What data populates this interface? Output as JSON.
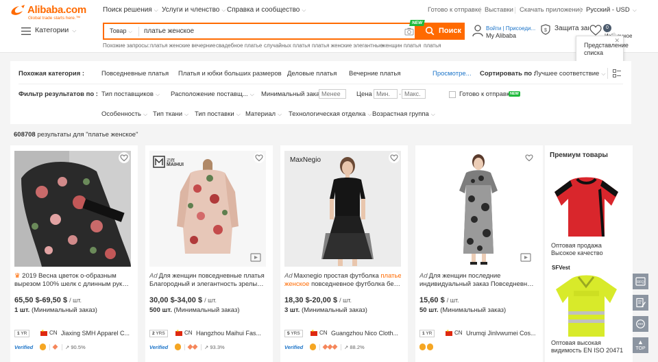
{
  "header": {
    "logo_word": "Alibaba.com",
    "logo_tagline": "Global trade starts here.™",
    "nav": [
      {
        "label": "Поиск решения"
      },
      {
        "label": "Услуги и членство"
      },
      {
        "label": "Справка и сообщество"
      }
    ],
    "right_nav": [
      {
        "label": "Готово к отправке"
      },
      {
        "label": "Выставки"
      },
      {
        "label": "Скачать приложение"
      },
      {
        "label": "Русский - USD"
      }
    ],
    "categories_label": "Категории",
    "search": {
      "type_label": "Товар",
      "query": "платье женское",
      "button_label": "Поиск",
      "new_badge": "NEW"
    },
    "related_searches": {
      "label": "Похожие запросы:",
      "items": [
        "платья женские вечерние",
        "свадебное платье",
        "случайных платья",
        "платья женские элегантные",
        "женщин платья",
        "платья"
      ]
    },
    "account": {
      "line1": "Войти | Присоеди...",
      "line2": "My Alibaba"
    },
    "protection_label": "Защита заказов",
    "favorites": {
      "count": "0",
      "label": "Избранное"
    },
    "tooltip": "Представление списка",
    "accent_color": "#ff6a00"
  },
  "filters": {
    "related_category_label": "Похожая категория :",
    "categories": [
      "Повседневные платья",
      "Платья и юбки больших размеров",
      "Деловые платья",
      "Вечерние платья"
    ],
    "view_more": "Просмотре...",
    "sort_label": "Сортировать по :",
    "sort_value": "Лучшее соответствие",
    "filter_label": "Фильтр результатов по :",
    "supplier_type": "Тип поставщиков",
    "supplier_location": "Расположение поставщ...",
    "min_order_label": "Минимальный заказ :",
    "min_order_placeholder": "Менее",
    "price_label": "Цена :",
    "price_min_placeholder": "Мин.",
    "price_max_placeholder": "Макс.",
    "ready_to_ship": "Готово к отправке",
    "new_tag": "NEW",
    "row3": [
      "Особенность",
      "Тип ткани",
      "Тип поставки",
      "Материал",
      "Технологическая отделка",
      "Возрастная группа"
    ]
  },
  "results": {
    "count": "608708",
    "text": "результаты для \"платье женское\""
  },
  "products": [
    {
      "ad": "",
      "title_line1": "2019 Весна цветок о-образным",
      "title_line2": "вырезом 100% шелк с длинным рукавом...",
      "price": "65,50 $-69,50 $",
      "unit": "/ шт.",
      "moq_qty": "1 шт.",
      "moq_label": "(Минимальный заказ)",
      "years": "1",
      "yrs_label": "YR",
      "country": "CN",
      "supplier": "Jiaxing SMH Apparel C...",
      "verified": "Verified",
      "rate": ""
    },
    {
      "ad": "Ad",
      "title_line1": "Для женщин повседневные платья",
      "title_line2": "Благородный и элегантность зрелые сти...",
      "price": "30,00 $-34,00 $",
      "unit": "/ шт.",
      "moq_qty": "500 шт.",
      "moq_label": "(Минимальный заказ)",
      "years": "2",
      "yrs_label": "YRS",
      "country": "CN",
      "supplier": "Hangzhou Maihui Fas...",
      "verified": "Verified",
      "rate": "93.3%",
      "brand": "MAIHUI"
    },
    {
      "ad": "Ad",
      "title_line1_pre": "Maxnegio простая футболка ",
      "title_line1_hl": "платье",
      "title_line2_hl": "женское",
      "title_line2_post": " повседневное футболка без...",
      "price": "18,30 $-20,00 $",
      "unit": "/ шт.",
      "moq_qty": "3 шт.",
      "moq_label": "(Минимальный заказ)",
      "years": "5",
      "yrs_label": "YRS",
      "country": "CN",
      "supplier": "Guangzhou Nico Cloth...",
      "verified": "Verified",
      "rate": "88.2%",
      "brand": "MaxNegio"
    },
    {
      "ad": "Ad",
      "title_line1": "Для женщин последние",
      "title_line2": "индивидуальный заказ Повседневная...",
      "price": "15,60 $",
      "unit": "/ шт.",
      "moq_qty": "50 шт.",
      "moq_label": "(Минимальный заказ)",
      "years": "1",
      "yrs_label": "YR",
      "country": "CN",
      "supplier": "Urumqi Jinlvwumei Cos...",
      "verified": "",
      "rate": ""
    }
  ],
  "premium": {
    "title": "Премиум товары",
    "items": [
      {
        "caption": "Оптовая продажа Высокое качество"
      },
      {
        "caption": "Оптовая высокая видимость EN ISO 20471",
        "brand": "SFVest"
      }
    ]
  },
  "sidebar": {
    "rfq": "RFQ",
    "top": "TOP"
  }
}
